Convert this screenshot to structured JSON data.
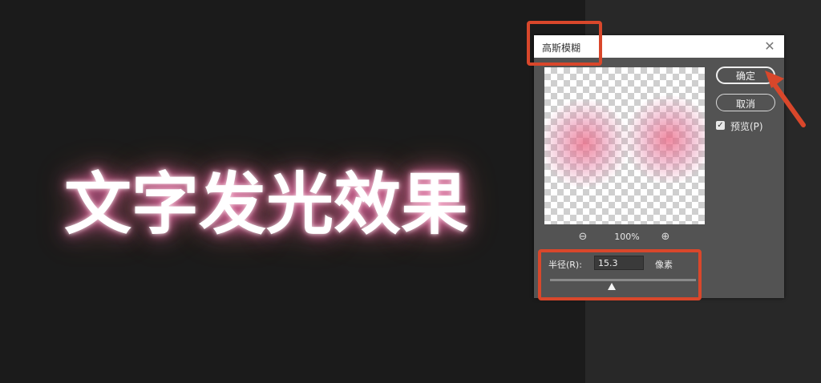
{
  "headline": "文字发光效果",
  "dialog": {
    "title": "高斯模糊",
    "close_icon": "close-icon",
    "ok_label": "确定",
    "cancel_label": "取消",
    "preview_label": "预览(P)",
    "preview_checked": true,
    "zoom_level": "100%",
    "zoom_out_icon": "zoom-out-icon",
    "zoom_in_icon": "zoom-in-icon",
    "radius_label": "半径(R):",
    "radius_value": "15.3",
    "radius_unit": "像素"
  },
  "colors": {
    "highlight": "#d9472b",
    "dialog_bg": "#535353",
    "canvas_bg": "#1b1b1b"
  }
}
